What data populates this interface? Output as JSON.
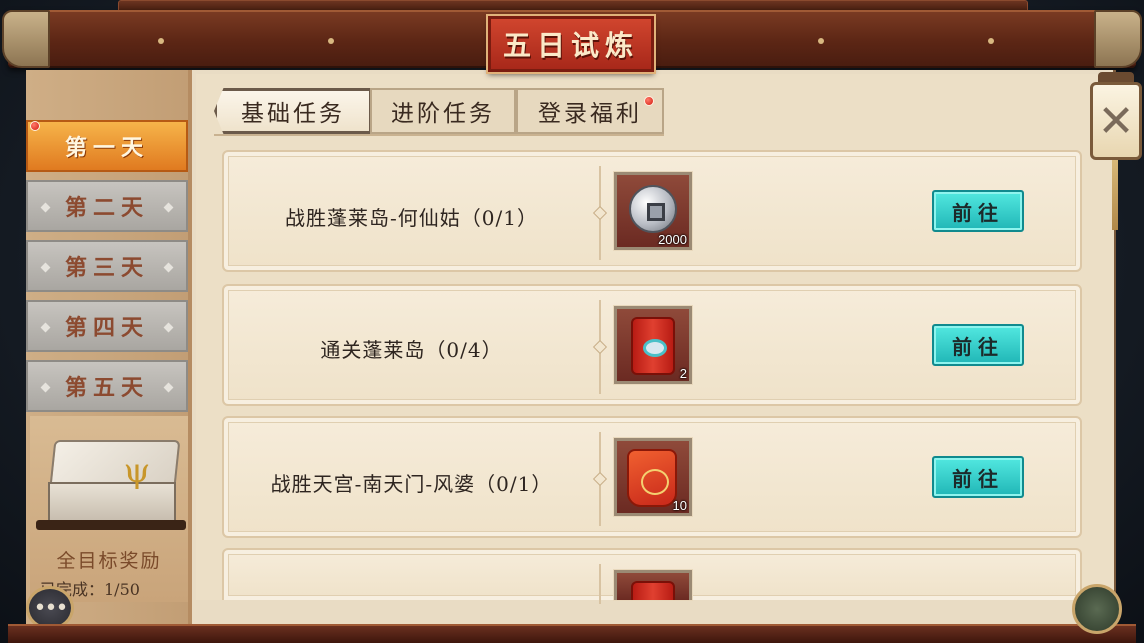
{
  "title": "五日试炼",
  "days": [
    {
      "label": "第一天",
      "active": true,
      "has_alert": true
    },
    {
      "label": "第二天",
      "active": false,
      "has_alert": false
    },
    {
      "label": "第三天",
      "active": false,
      "has_alert": false
    },
    {
      "label": "第四天",
      "active": false,
      "has_alert": false
    },
    {
      "label": "第五天",
      "active": false,
      "has_alert": false
    }
  ],
  "tabs": [
    {
      "label": "基础任务",
      "active": true,
      "has_alert": false
    },
    {
      "label": "进阶任务",
      "active": false,
      "has_alert": false
    },
    {
      "label": "登录福利",
      "active": false,
      "has_alert": true
    }
  ],
  "tasks": [
    {
      "name": "战胜蓬莱岛-何仙姑（0/1）",
      "reward_icon": "coin-icon",
      "reward_count": "2000",
      "button": "前往"
    },
    {
      "name": "通关蓬莱岛（0/4）",
      "reward_icon": "scroll-icon",
      "reward_count": "2",
      "button": "前往"
    },
    {
      "name": "战胜天宫-南天门-风婆（0/1）",
      "reward_icon": "pouch-icon",
      "reward_count": "10",
      "button": "前往"
    },
    {
      "name": "",
      "reward_icon": "scroll-icon",
      "reward_count": "",
      "button": ""
    }
  ],
  "reward_box": {
    "title": "全目标奖励",
    "progress": "已完成：1/50"
  },
  "colors": {
    "accent_active_day": "#e07a20",
    "go_button": "#20b6b6",
    "title_plaque": "#a8281a"
  },
  "icons": {
    "close": "close-icon",
    "chat": "chat-icon",
    "chest": "treasure-chest-icon"
  }
}
